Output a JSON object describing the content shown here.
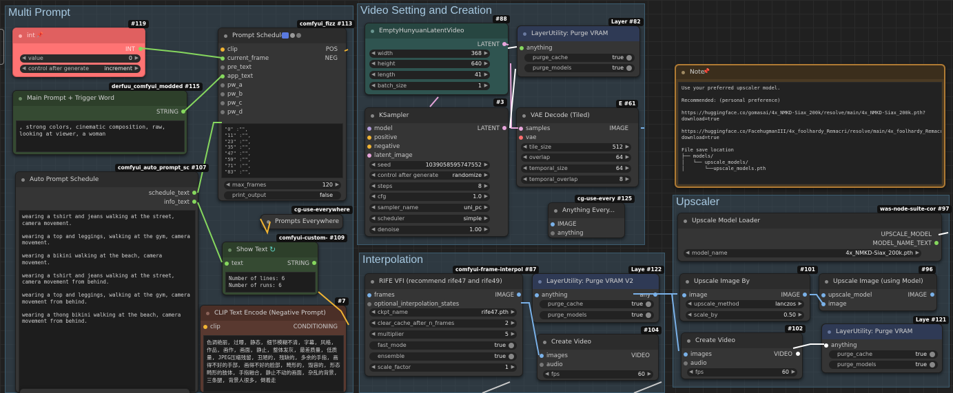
{
  "colors": {
    "canvas": "#202020",
    "group": "#3a4f5c",
    "node": "#353535",
    "red_node": "#ff7373",
    "green_node": "#354a32",
    "brown_node": "#593930",
    "note_border": "#b07b34",
    "slot_green": "#86d85e",
    "slot_yellow": "#f1b433",
    "slot_pink": "#e7a5db",
    "slot_blue": "#7ab1e8",
    "slot_purple": "#b39ddb"
  },
  "groups": {
    "multi_prompt": "Multi Prompt",
    "video_setting": "Video Setting and Creation",
    "interpolation": "Interpolation",
    "upscaler": "Upscaler"
  },
  "n119": {
    "badge": "#119",
    "title": "int",
    "out": "INT",
    "value_label": "value",
    "value": "0",
    "control_label": "control after generate",
    "control": "increment"
  },
  "n115": {
    "badge": "derfuu_comfyui_modded #115",
    "title": "Main Prompt + Trigger Word",
    "out": "STRING",
    "text": ", strong colors, cinematic composition, raw, looking at viewer, a woman"
  },
  "n113": {
    "badge": "comfyui_fizz #113",
    "title": "Prompt Schedule",
    "in_clip": "clip",
    "in_current_frame": "current_frame",
    "in_pre_text": "pre_text",
    "in_app_text": "app_text",
    "in_pw_a": "pw_a",
    "in_pw_b": "pw_b",
    "in_pw_c": "pw_c",
    "in_pw_d": "pw_d",
    "out_pos": "POS",
    "out_neg": "NEG",
    "schedule": "\"0\" :\"\",\n\"11\" :\"\",\n\"23\" :\"\",\n\"35\" :\"\",\n\"47\" :\"\",\n\"59\" :\"\",\n\"71\" :\"\",\n\"83\" :\"\",",
    "max_frames_label": "max_frames",
    "max_frames": "120",
    "print_output_label": "print_output",
    "print_output": "false"
  },
  "n107": {
    "badge": "comfyui_auto_prompt_sc #107",
    "title": "Auto Prompt Schedule",
    "out_schedule": "schedule_text",
    "out_info": "info_text",
    "text": "wearing a tshirt and jeans walking at the street, camera movement.\n\nwearing a top and leggings, walking at the gym, camera movement.\n\nwearing a bikini walking at the beach, camera movement.\n\nwearing a tshirt and jeans walking at the street, camera movement from behind.\n\nwearing a top and leggings, walking at the gym, camera movement from behind.\n\nwearing a thong bikini walking at the beach, camera movement from behind."
  },
  "prompts_everywhere": {
    "badge": "cg-use-everywhere",
    "title": "Prompts Everywhere"
  },
  "n109": {
    "badge": "comfyui-custom- #109",
    "title": "Show Text",
    "in_text": "text",
    "out": "STRING",
    "text": "Number of lines: 6\nNumber of runs: 6"
  },
  "n7": {
    "badge": "#7",
    "title": "CLIP Text Encode (Negative Prompt)",
    "in_clip": "clip",
    "out": "CONDITIONING",
    "text": "色调艳丽, 过曝, 静态, 细节模糊不清, 字幕, 风格, 作品, 画作, 画面, 静止, 整体发灰, 最差质量, 低质量, JPEG压缩残留, 丑陋的, 残缺的, 多余的手指, 画得不好的手部, 画得不好的脸部, 畸形的, 毁容的, 形态畸形的肢体, 手指融合, 静止不动的画面, 杂乱的背景, 三条腿, 背景人很多, 倒着走"
  },
  "n88": {
    "badge": "#88",
    "title": "EmptyHunyuanLatentVideo",
    "out": "LATENT",
    "width_label": "width",
    "width": "368",
    "height_label": "height",
    "height": "640",
    "length_label": "length",
    "length": "41",
    "batch_label": "batch_size",
    "batch": "1"
  },
  "n82": {
    "badge": "Layer #82",
    "title": "LayerUtility: Purge VRAM",
    "in": "anything",
    "cache_label": "purge_cache",
    "cache": "true",
    "models_label": "purge_models",
    "models": "true"
  },
  "n3": {
    "badge": "#3",
    "title": "KSampler",
    "in_model": "model",
    "in_positive": "positive",
    "in_negative": "negative",
    "in_latent": "latent_image",
    "out": "LATENT",
    "seed_label": "seed",
    "seed": "1039058595747552",
    "control_label": "control after generate",
    "control": "randomize",
    "steps_label": "steps",
    "steps": "8",
    "cfg_label": "cfg",
    "cfg": "1.0",
    "sampler_label": "sampler_name",
    "sampler": "uni_pc",
    "scheduler_label": "scheduler",
    "scheduler": "simple",
    "denoise_label": "denoise",
    "denoise": "1.00"
  },
  "n61": {
    "badge": "E #61",
    "title": "VAE Decode (Tiled)",
    "in_samples": "samples",
    "in_vae": "vae",
    "out": "IMAGE",
    "tile_label": "tile_size",
    "tile": "512",
    "overlap_label": "overlap",
    "overlap": "64",
    "tsize_label": "temporal_size",
    "tsize": "64",
    "toverlap_label": "temporal_overlap",
    "toverlap": "8"
  },
  "n125": {
    "badge": "cg-use-every #125",
    "title": "Anything Every...",
    "in_image": "IMAGE",
    "in_anything": "anything"
  },
  "note": {
    "title": "Note",
    "text": "Use your preferred upscaler model.\n\nRecommended: (personal preference)\n\nhttps://huggingface.co/gomasai/4x_NMKD-Siax_200k/resolve/main/4x_NMKD-Siax_200k.pth?download=true\n\nhttps://huggingface.co/FacehugmanIII/4x_foolhardy_Remacri/resolve/main/4x_foolhardy_Remacri.pth?download=true\n\nFile save location\n├── models/\n│   └── upscale_models/\n│       └──upscale_models.pth"
  },
  "n97": {
    "badge": "was-node-suite-cor #97",
    "title": "Upscale Model Loader",
    "out_model": "UPSCALE_MODEL",
    "out_name": "MODEL_NAME_TEXT",
    "model_label": "model_name",
    "model": "4x_NMKD-Siax_200k.pth"
  },
  "n87": {
    "badge": "comfyui-frame-interpol #87",
    "title": "RIFE VFI (recommend rife47 and rife49)",
    "in_frames": "frames",
    "in_states": "optional_interpolation_states",
    "out": "IMAGE",
    "ckpt_label": "ckpt_name",
    "ckpt": "rife47.pth",
    "clear_label": "clear_cache_after_n_frames",
    "clear": "2",
    "mult_label": "multiplier",
    "mult": "5",
    "fast_label": "fast_mode",
    "fast": "true",
    "ens_label": "ensemble",
    "ens": "true",
    "scale_label": "scale_factor",
    "scale": "1"
  },
  "n122": {
    "badge": "Laye #122",
    "title": "LayerUtility: Purge VRAM V2",
    "in": "anything",
    "out": "any",
    "cache_label": "purge_cache",
    "cache": "true",
    "models_label": "purge_models",
    "models": "true"
  },
  "n104": {
    "badge": "#104",
    "title": "Create Video",
    "in_images": "images",
    "in_audio": "audio",
    "out": "VIDEO",
    "fps_label": "fps",
    "fps": "60"
  },
  "n101": {
    "badge": "#101",
    "title": "Upscale Image By",
    "in_image": "image",
    "out": "IMAGE",
    "method_label": "upscale_method",
    "method": "lanczos",
    "scale_label": "scale_by",
    "scale": "0.50"
  },
  "n96": {
    "badge": "#96",
    "title": "Upscale Image (using Model)",
    "in_model": "upscale_model",
    "in_image": "image",
    "out": "IMAGE"
  },
  "n102": {
    "badge": "#102",
    "title": "Create Video",
    "in_images": "images",
    "in_audio": "audio",
    "out": "VIDEO",
    "fps_label": "fps",
    "fps": "60"
  },
  "n121": {
    "badge": "Laye #121",
    "title": "LayerUtility: Purge VRAM",
    "in": "anything",
    "cache_label": "purge_cache",
    "cache": "true",
    "models_label": "purge_models",
    "models": "true"
  }
}
